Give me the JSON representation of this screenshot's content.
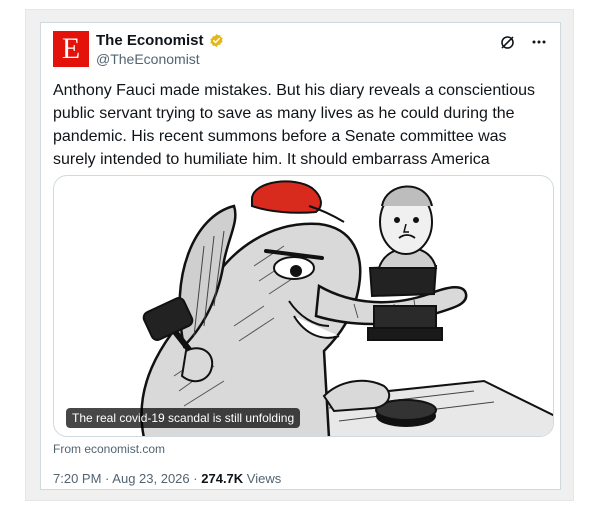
{
  "author": {
    "name": "The Economist",
    "handle": "@TheEconomist",
    "avatar_letter": "E",
    "brand_color": "#e3120b",
    "verified_color": "#e2b719"
  },
  "actions": {
    "grok_icon": "grok-slash-circle-icon",
    "more_icon": "more-dots-icon"
  },
  "tweet": {
    "text": "Anthony Fauci made mistakes. But his diary reveals a conscientious public servant trying to save as many lives as he could during the pandemic. His recent summons before a Senate committee was surely intended to humiliate him. It should embarrass America"
  },
  "card": {
    "caption": "The real covid-19 scandal is still unfolding",
    "source": "From economist.com"
  },
  "meta": {
    "time": "7:20 PM",
    "separator": "·",
    "date": "Aug 23, 2026",
    "views_count": "274.7K",
    "views_label": "Views"
  }
}
